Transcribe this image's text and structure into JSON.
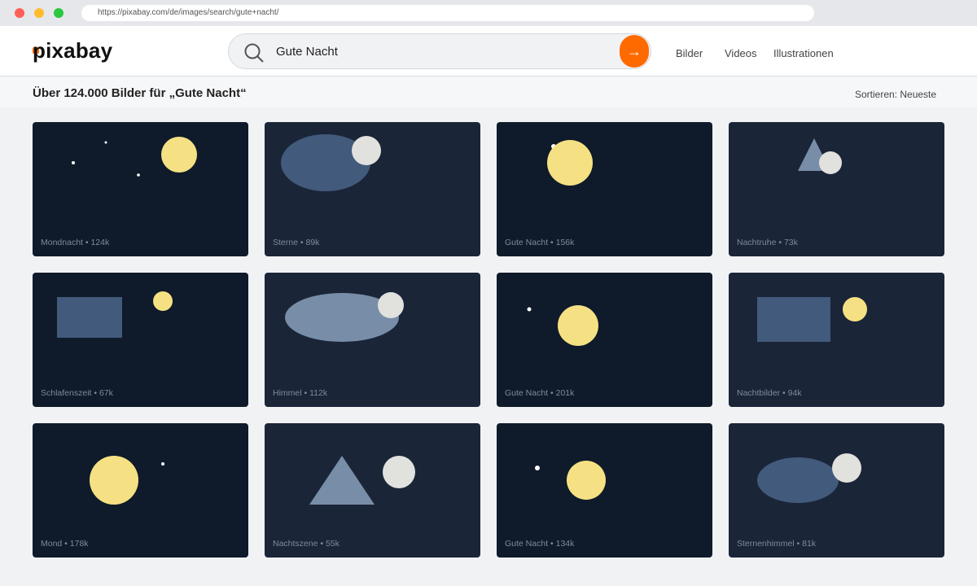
{
  "browser": {
    "url": "https://pixabay.com/de/images/search/gute+nacht/"
  },
  "header": {
    "logo": "pixabay",
    "search_value": "Gute Nacht",
    "search_button_glyph": "→",
    "nav": [
      "Bilder",
      "Videos",
      "Illustrationen"
    ]
  },
  "results": {
    "title": "Über 124.000 Bilder für „Gute Nacht“",
    "sort_label": "Sortieren: Neueste"
  },
  "colors": {
    "accent": "#ff6a00",
    "tile_dark": "#0f1a2a",
    "tile_mid": "#1b2538",
    "moon_yellow": "#f5e183",
    "moon_white": "#e1e1dd",
    "cloud_dark": "#425a7c",
    "cloud_light": "#788ea8",
    "caption": "#7f8a9a"
  },
  "tiles": [
    {
      "caption": "Mondnacht • 124k",
      "bg": "dark",
      "scene": "stars-moon"
    },
    {
      "caption": "Sterne • 89k",
      "bg": "mid",
      "scene": "cloud-moon"
    },
    {
      "caption": "Gute Nacht • 156k",
      "bg": "dark",
      "scene": "big-moon"
    },
    {
      "caption": "Nachtruhe • 73k",
      "bg": "mid",
      "scene": "triangle-moon"
    },
    {
      "caption": "Schlafenszeit • 67k",
      "bg": "dark",
      "scene": "rect-moon"
    },
    {
      "caption": "Himmel • 112k",
      "bg": "mid",
      "scene": "lightcloud-moon"
    },
    {
      "caption": "Gute Nacht • 201k",
      "bg": "dark",
      "scene": "star-moon"
    },
    {
      "caption": "Nachtbilder • 94k",
      "bg": "mid",
      "scene": "rect-moon-2"
    },
    {
      "caption": "Mond • 178k",
      "bg": "dark",
      "scene": "moon-star"
    },
    {
      "caption": "Nachtszene • 55k",
      "bg": "mid",
      "scene": "triangle-moon-2"
    },
    {
      "caption": "Gute Nacht • 134k",
      "bg": "dark",
      "scene": "star-moon-2"
    },
    {
      "caption": "Sternenhimmel • 81k",
      "bg": "mid",
      "scene": "cloud-moon-2"
    }
  ]
}
